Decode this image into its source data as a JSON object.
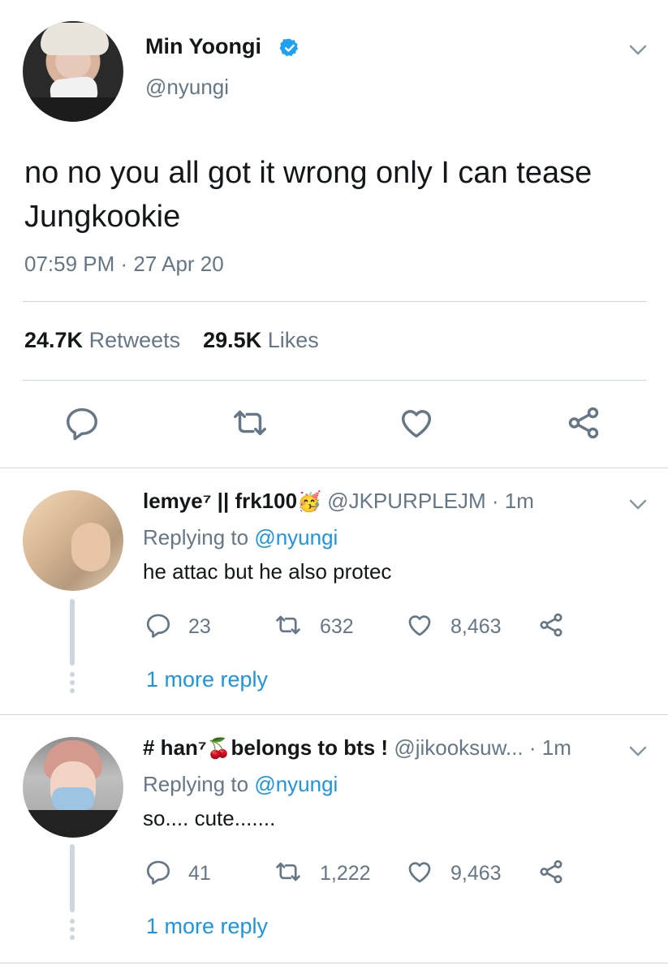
{
  "tweet": {
    "display_name": "Min Yoongi",
    "handle": "@nyungi",
    "text": "no no you all got it wrong only I can tease Jungkookie",
    "timestamp": "07:59 PM · 27 Apr 20",
    "retweets_count": "24.7K",
    "retweets_label": "Retweets",
    "likes_count": "29.5K",
    "likes_label": "Likes",
    "icons": {
      "verified": "verified-badge-icon",
      "menu": "chevron-down-icon",
      "reply": "reply-icon",
      "retweet": "retweet-icon",
      "like": "heart-icon",
      "share": "share-icon"
    }
  },
  "replies": [
    {
      "display_name": "lemye⁷ || frk100",
      "name_emoji": "🥳",
      "handle": "@JKPURPLEJM",
      "time": "· 1m",
      "replying_prefix": "Replying to",
      "replying_to": "@nyungi",
      "text": "he attac but he also protec",
      "reply_count": "23",
      "retweet_count": "632",
      "like_count": "8,463",
      "more_reply": "1 more reply"
    },
    {
      "display_name": "# han⁷",
      "name_emoji": "🍒",
      "display_name_suffix": "belongs to bts !",
      "handle": "@jikooksuw...",
      "time": "· 1m",
      "replying_prefix": "Replying to",
      "replying_to": "@nyungi",
      "text": "so.... cute.......",
      "reply_count": "41",
      "retweet_count": "1,222",
      "like_count": "9,463",
      "more_reply": "1 more reply"
    }
  ],
  "colors": {
    "accent": "#1b95e0",
    "verified": "#1da1f2",
    "secondary_text": "#657786",
    "divider": "#ccd6dd",
    "icon": "#657786"
  }
}
